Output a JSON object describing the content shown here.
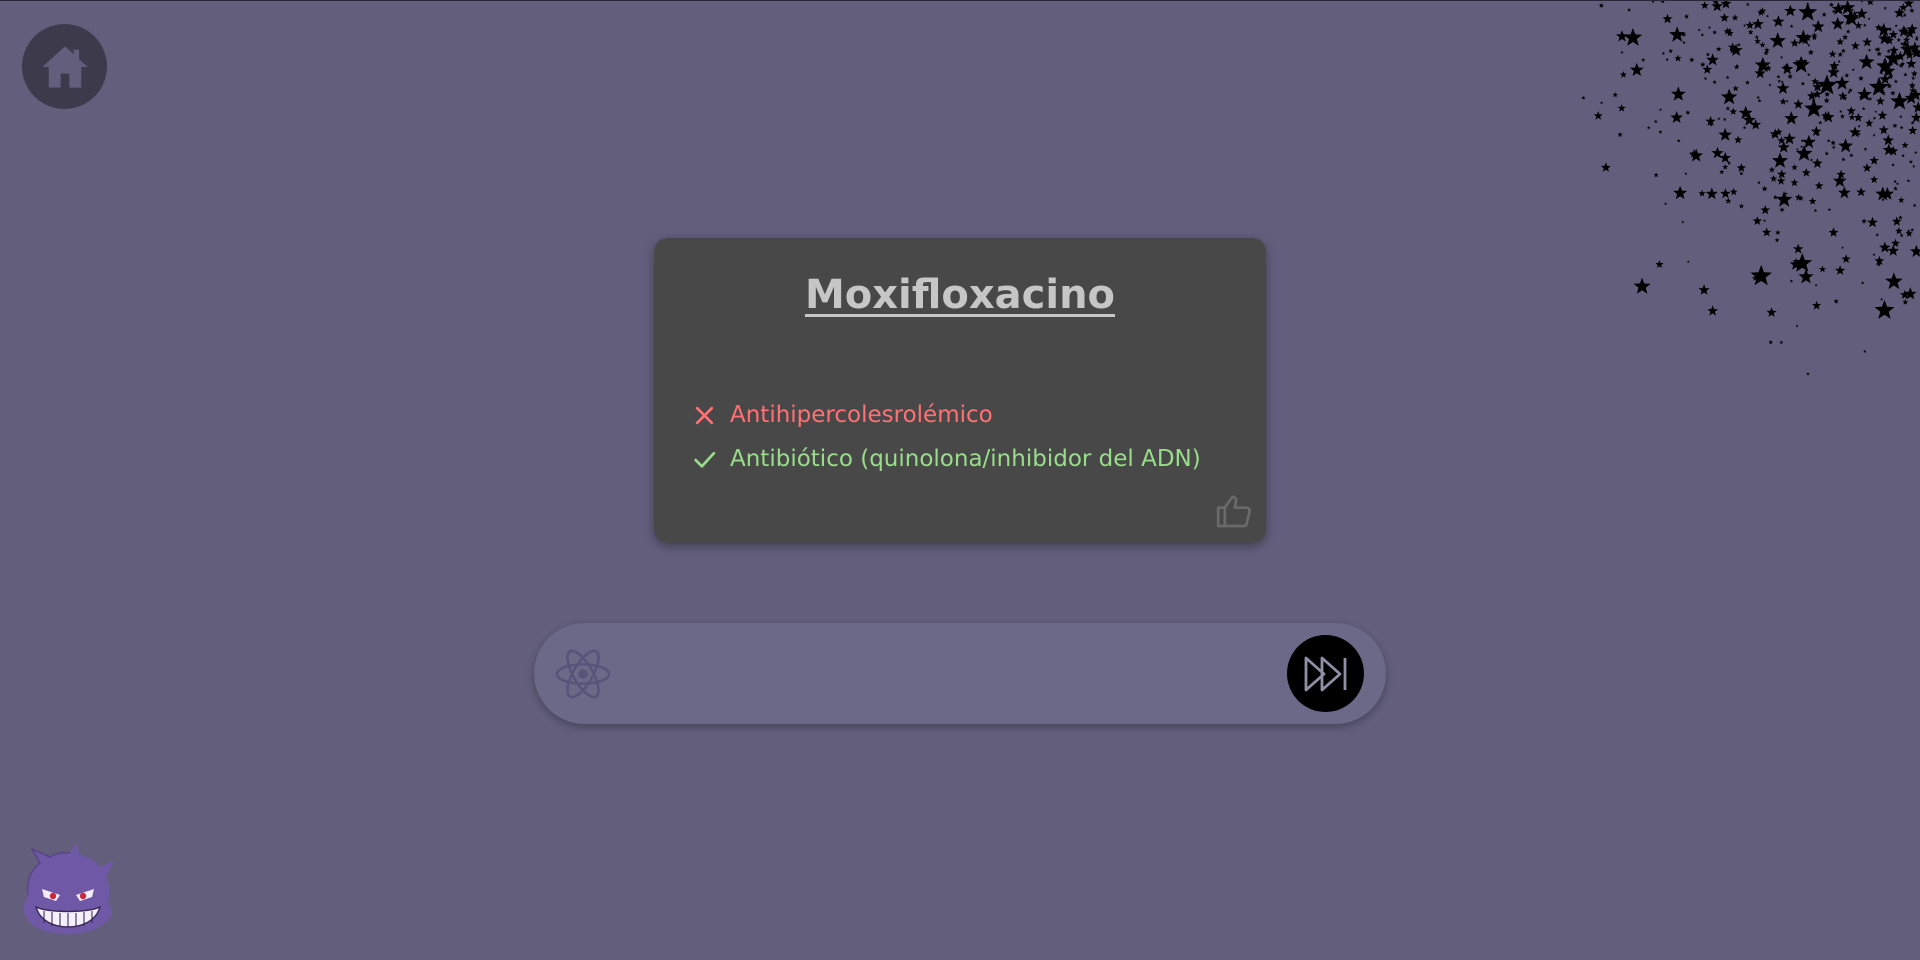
{
  "nav": {
    "home_icon": "home-icon"
  },
  "card": {
    "title": "Moxifloxacino",
    "answers": [
      {
        "text": "Antihipercolesrolémico",
        "status": "wrong",
        "icon": "x-mark-icon"
      },
      {
        "text": "Antibiótico (quinolona/inhibidor del ADN)",
        "status": "correct",
        "icon": "check-mark-icon"
      }
    ],
    "like_icon": "thumbs-up-icon"
  },
  "input_bar": {
    "icon": "atom-icon",
    "value": "",
    "placeholder": "",
    "skip_icon": "fast-forward-icon"
  },
  "decorations": {
    "stars": "stars-decoration",
    "mascot": "gengar-mascot"
  },
  "colors": {
    "background": "#625e7c",
    "card": "#484848",
    "wrong": "#ff7174",
    "correct": "#99dd8a",
    "input_bar": "#6b6888"
  }
}
